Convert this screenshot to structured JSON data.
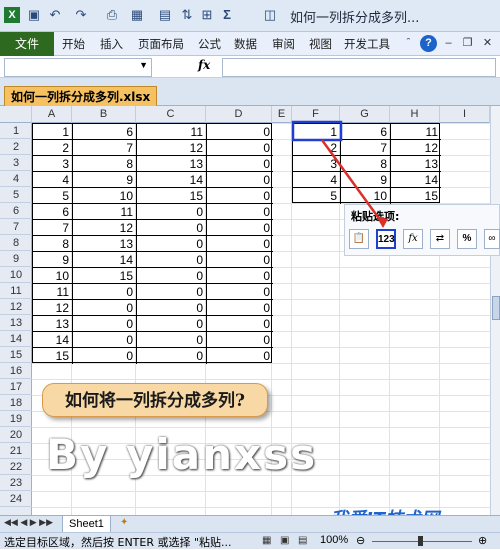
{
  "window": {
    "title": "如何一列拆分成多列..."
  },
  "qat": {
    "icons": [
      "excel-icon",
      "save-icon",
      "undo-icon",
      "redo-icon",
      "print-preview-icon",
      "borders-icon",
      "table-icon",
      "sort-icon",
      "grid-icon",
      "autosum-icon",
      "filter-icon"
    ]
  },
  "ribbon": {
    "file_label": "文件",
    "tabs": [
      "开始",
      "插入",
      "页面布局",
      "公式",
      "数据",
      "审阅",
      "视图",
      "开发工具"
    ]
  },
  "formula_bar": {
    "fx_label": "fx",
    "name_value": "",
    "formula_value": ""
  },
  "workbook": {
    "tab_label": "如何一列拆分成多列.xlsx"
  },
  "columns": [
    "A",
    "B",
    "C",
    "D",
    "E",
    "F",
    "G",
    "H",
    "I"
  ],
  "rows": [
    "1",
    "2",
    "3",
    "4",
    "5",
    "6",
    "7",
    "8",
    "9",
    "10",
    "11",
    "12",
    "13",
    "14",
    "15",
    "16",
    "17",
    "18",
    "19",
    "20",
    "21",
    "22",
    "23",
    "24"
  ],
  "table_left": [
    [
      "1",
      "6",
      "11",
      "0"
    ],
    [
      "2",
      "7",
      "12",
      "0"
    ],
    [
      "3",
      "8",
      "13",
      "0"
    ],
    [
      "4",
      "9",
      "14",
      "0"
    ],
    [
      "5",
      "10",
      "15",
      "0"
    ],
    [
      "6",
      "11",
      "0",
      "0"
    ],
    [
      "7",
      "12",
      "0",
      "0"
    ],
    [
      "8",
      "13",
      "0",
      "0"
    ],
    [
      "9",
      "14",
      "0",
      "0"
    ],
    [
      "10",
      "15",
      "0",
      "0"
    ],
    [
      "11",
      "0",
      "0",
      "0"
    ],
    [
      "12",
      "0",
      "0",
      "0"
    ],
    [
      "13",
      "0",
      "0",
      "0"
    ],
    [
      "14",
      "0",
      "0",
      "0"
    ],
    [
      "15",
      "0",
      "0",
      "0"
    ]
  ],
  "table_right": [
    [
      "1",
      "6",
      "11"
    ],
    [
      "2",
      "7",
      "12"
    ],
    [
      "3",
      "8",
      "13"
    ],
    [
      "4",
      "9",
      "14"
    ],
    [
      "5",
      "10",
      "15"
    ]
  ],
  "paste_options": {
    "title": "粘贴选项:",
    "buttons": [
      "paste-icon",
      "123",
      "fx",
      "transpose-icon",
      "%",
      "link-icon"
    ]
  },
  "callout": {
    "text": "如何将一列拆分成多列?"
  },
  "watermark": {
    "text": "By yianxss",
    "site": "我爱IT技术网"
  },
  "sheets": {
    "active": "Sheet1"
  },
  "status": {
    "message": "选定目标区域，然后按 ENTER 或选择 \"粘贴...",
    "zoom": "100%"
  },
  "colors": {
    "file_tab": "#2d6a1f",
    "highlight": "#1f3fd0",
    "arrow": "#d9302a",
    "callout_fill": "#f8d9a6"
  }
}
